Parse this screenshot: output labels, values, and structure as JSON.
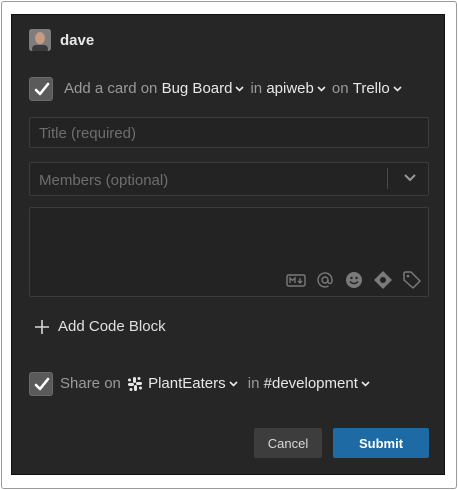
{
  "user": {
    "name": "dave"
  },
  "trello": {
    "checked": true,
    "prefix": "Add a card on",
    "board": "Bug Board",
    "in_word": "in",
    "list": "apiweb",
    "on_word": "on",
    "service": "Trello"
  },
  "form": {
    "title_placeholder": "Title (required)",
    "members_placeholder": "Members (optional)",
    "description_value": ""
  },
  "toolbar_icons": [
    "markdown-icon",
    "mention-icon",
    "emoji-icon",
    "codemark-icon",
    "tag-icon"
  ],
  "add_code_block_label": "Add Code Block",
  "share": {
    "checked": true,
    "prefix": "Share on",
    "workspace": "PlantEaters",
    "in_word": "in",
    "channel": "#development"
  },
  "buttons": {
    "cancel": "Cancel",
    "submit": "Submit"
  },
  "colors": {
    "panel_bg": "#262626",
    "submit_bg": "#1e6aa5",
    "cancel_bg": "#3d3d3d"
  }
}
